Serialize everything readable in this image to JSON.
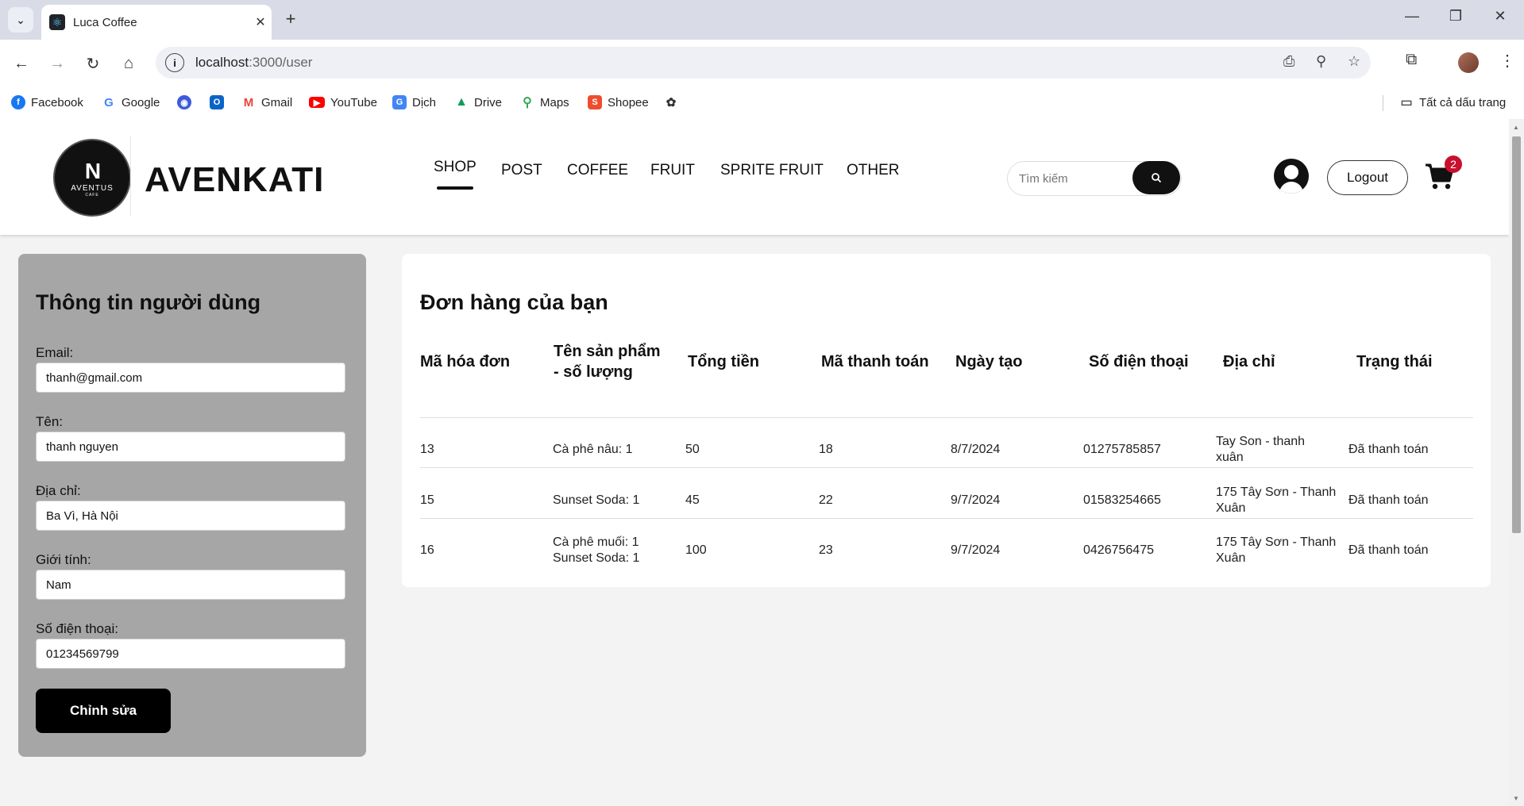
{
  "browser": {
    "tab_title": "Luca Coffee",
    "url_host": "localhost",
    "url_path": ":3000/user",
    "bookmarks": [
      {
        "label": "Facebook",
        "icon": "facebook-icon",
        "color": "#1877f2"
      },
      {
        "label": "Google",
        "icon": "google-icon",
        "color": "#4285f4"
      },
      {
        "label": "",
        "icon": "app-icon-1",
        "color": "#3b5bdb"
      },
      {
        "label": "",
        "icon": "outlook-icon",
        "color": "#0a64c8"
      },
      {
        "label": "Gmail",
        "icon": "gmail-icon",
        "color": "#ea4335"
      },
      {
        "label": "YouTube",
        "icon": "youtube-icon",
        "color": "#ff0000"
      },
      {
        "label": "Dịch",
        "icon": "translate-icon",
        "color": "#4285f4"
      },
      {
        "label": "Drive",
        "icon": "drive-icon",
        "color": "#0f9d58"
      },
      {
        "label": "Maps",
        "icon": "maps-icon",
        "color": "#34a853"
      },
      {
        "label": "Shopee",
        "icon": "shopee-icon",
        "color": "#ee4d2d"
      },
      {
        "label": "",
        "icon": "openai-icon",
        "color": "#333333"
      }
    ],
    "all_bookmarks": "Tất cả dấu trang"
  },
  "header": {
    "logo_mark": "N",
    "logo_brand": "AVENTUS",
    "logo_sub": "CAFE",
    "site_title": "AVENKATI",
    "menu": [
      "SHOP",
      "POST",
      "COFFEE",
      "FRUIT",
      "SPRITE FRUIT",
      "OTHER"
    ],
    "active_menu": "SHOP",
    "search_placeholder": "Tìm kiếm",
    "logout_label": "Logout",
    "cart_count": "2"
  },
  "user_panel": {
    "title": "Thông tin người dùng",
    "fields": [
      {
        "label": "Email:",
        "value": "thanh@gmail.com"
      },
      {
        "label": "Tên:",
        "value": "thanh nguyen"
      },
      {
        "label": "Địa chỉ:",
        "value": "Ba Vì, Hà Nội"
      },
      {
        "label": "Giới tính:",
        "value": "Nam"
      },
      {
        "label": "Số điện thoại:",
        "value": "01234569799"
      }
    ],
    "edit_label": "Chỉnh sửa"
  },
  "orders": {
    "title": "Đơn hàng của bạn",
    "columns": [
      "Mã hóa đơn",
      "Tên sản phẩm\n- số lượng",
      "Tổng tiền",
      "Mã thanh toán",
      "Ngày tạo",
      "Số điện thoại",
      "Địa chỉ",
      "Trạng thái"
    ],
    "rows": [
      {
        "id": "13",
        "products": "Cà phê nâu: 1",
        "total": "50",
        "payment_id": "18",
        "date": "8/7/2024",
        "phone": "01275785857",
        "address": "Tay Son - thanh\nxuân",
        "status": "Đã thanh toán"
      },
      {
        "id": "15",
        "products": "Sunset Soda: 1",
        "total": "45",
        "payment_id": "22",
        "date": "9/7/2024",
        "phone": "01583254665",
        "address": "175 Tây Sơn - Thanh\nXuân",
        "status": "Đã thanh toán"
      },
      {
        "id": "16",
        "products": "Cà phê muối: 1\nSunset Soda: 1",
        "total": "100",
        "payment_id": "23",
        "date": "9/7/2024",
        "phone": "0426756475",
        "address": "175 Tây Sơn - Thanh\nXuân",
        "status": "Đã thanh toán"
      }
    ]
  }
}
